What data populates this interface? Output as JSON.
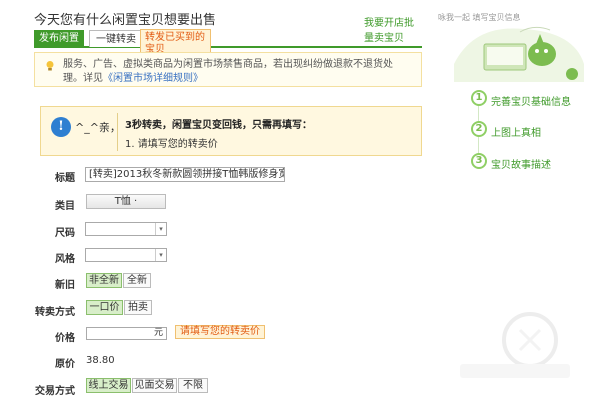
{
  "header": {
    "title": "今天您有什么闲置宝贝想要出售",
    "tab_active": "发布闲置",
    "tab_inactive": "一键转卖",
    "tab_tooltip": "转发已买到的宝贝",
    "bulk_link": "我要开店批量卖宝贝"
  },
  "notice": {
    "text": "服务、广告、虚拟类商品为闲置市场禁售商品，若出现纠纷做退款不退货处理。详见",
    "link": "《闲置市场详细规则》",
    "icon": "lightbulb-icon"
  },
  "info": {
    "greeting": "^_^亲，",
    "heading": "3秒转卖，闲置宝贝变回钱，只需再填写：",
    "item": "1. 请填写您的转卖价"
  },
  "form": {
    "title_label": "标题",
    "title_value": "[转卖]2013秋冬新款圆领拼接T恤韩版修身宽松女",
    "category_label": "类目",
    "category_value": "T恤",
    "size_label": "尺码",
    "style_label": "风格",
    "condition_label": "新旧",
    "condition_options": [
      "非全新",
      "全新"
    ],
    "condition_selected": "非全新",
    "mode_label": "转卖方式",
    "mode_options": [
      "一口价",
      "拍卖"
    ],
    "mode_selected": "一口价",
    "price_label": "价格",
    "price_unit": "元",
    "price_tip": "请填写您的转卖价",
    "orig_label": "原价",
    "orig_value": "38.80",
    "trade_label": "交易方式",
    "trade_options": [
      "线上交易",
      "见面交易",
      "不限"
    ],
    "trade_selected": "线上交易"
  },
  "steps": [
    {
      "num": "1",
      "label": "完善宝贝基础信息"
    },
    {
      "num": "2",
      "label": "上图上真相"
    },
    {
      "num": "3",
      "label": "宝贝故事描述"
    }
  ],
  "corner_art": {
    "caption": "咏我一起 填写宝贝信息"
  },
  "colors": {
    "brand_green": "#3f9a2a",
    "tip_orange": "#e25b12",
    "info_blue": "#2e7fd1"
  }
}
